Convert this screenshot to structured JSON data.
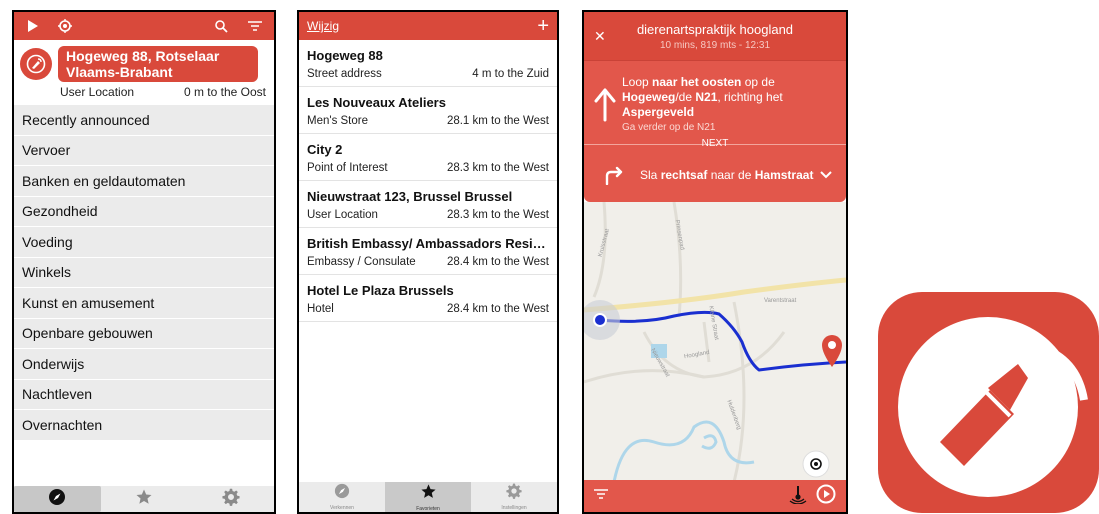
{
  "screen1": {
    "location": {
      "title": "Hogeweg 88, Rotselaar Vlaams-Brabant",
      "type": "User Location",
      "distance": "0 m to the Oost"
    },
    "categories": [
      "Recently announced",
      "Vervoer",
      "Banken en geldautomaten",
      "Gezondheid",
      "Voeding",
      "Winkels",
      "Kunst en amusement",
      "Openbare gebouwen",
      "Onderwijs",
      "Nachtleven",
      "Overnachten"
    ]
  },
  "screen2": {
    "edit_label": "Wijzig",
    "favorites": [
      {
        "name": "Hogeweg 88",
        "type": "Street address",
        "distance": "4 m to the Zuid"
      },
      {
        "name": "Les Nouveaux Ateliers",
        "type": "Men's Store",
        "distance": "28.1 km to the West"
      },
      {
        "name": "City 2",
        "type": "Point of Interest",
        "distance": "28.3 km to the West"
      },
      {
        "name": "Nieuwstraat 123, Brussel Brussel",
        "type": "User Location",
        "distance": "28.3 km to the West"
      },
      {
        "name": "British Embassy/ Ambassadors Resid...",
        "type": "Embassy / Consulate",
        "distance": "28.4 km to the West"
      },
      {
        "name": "Hotel Le Plaza Brussels",
        "type": "Hotel",
        "distance": "28.4 km to the West"
      }
    ],
    "tabs": [
      "Verkennen",
      "Favorieten",
      "Instellingen"
    ]
  },
  "screen3": {
    "destination": "dierenartspraktijk hoogland",
    "eta": "10 mins, 819 mts - 12:31",
    "step1": {
      "pre": "Loop ",
      "dir": "naar het oosten",
      "mid": " op de ",
      "street": "Hogeweg",
      "sep": "/de ",
      "road": "N21",
      "tail": ", richting het ",
      "target": "Aspergeveld",
      "sub": "Ga verder op de N21"
    },
    "next_label": "NEXT",
    "step2": {
      "pre": "Sla ",
      "dir": "rechtsaf",
      "mid": " naar de ",
      "street": "Hamstraat"
    },
    "map_labels": [
      "Varentstraat",
      "Hoogland",
      "Prinsenpad",
      "Kruisstraat",
      "Nieuwstraat",
      "Kleine Straat",
      "Huldenberg"
    ]
  },
  "colors": {
    "primary": "#d9493b",
    "secondary": "#e2574b",
    "route": "#1a2fd0"
  }
}
